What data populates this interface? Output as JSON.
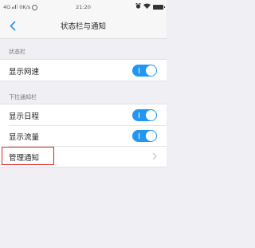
{
  "status_bar": {
    "network": "4G",
    "speed": "0K/s",
    "time": "21:20"
  },
  "nav": {
    "title": "状态栏与通知"
  },
  "sections": {
    "status_bar": {
      "header": "状态栏",
      "show_speed_label": "显示网速",
      "show_speed_on": true
    },
    "pulldown": {
      "header": "下拉通知栏",
      "show_schedule_label": "显示日程",
      "show_schedule_on": true,
      "show_data_label": "显示流量",
      "show_data_on": true,
      "manage_notifications_label": "管理通知"
    }
  },
  "colors": {
    "toggle_on": "#2196f3",
    "highlight": "#e02020"
  }
}
